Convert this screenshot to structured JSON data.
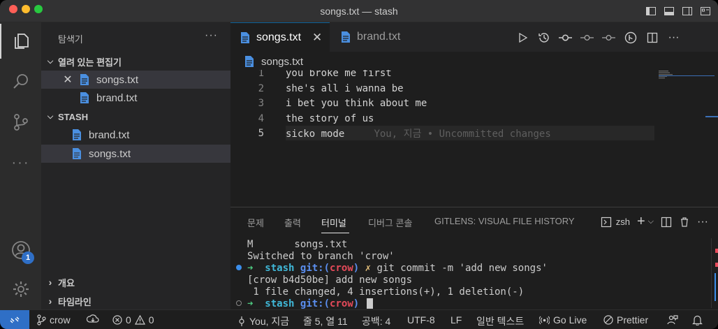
{
  "window": {
    "title": "songs.txt — stash"
  },
  "sidebar": {
    "title": "탐색기",
    "more": "···",
    "open_editors_label": "열려 있는 편집기",
    "open_editors": [
      {
        "label": "songs.txt",
        "selected": true,
        "close": "✕"
      },
      {
        "label": "brand.txt",
        "selected": false
      }
    ],
    "folder_label": "STASH",
    "folder_files": [
      {
        "label": "brand.txt",
        "selected": false
      },
      {
        "label": "songs.txt",
        "selected": true
      }
    ],
    "outline_label": "개요",
    "timeline_label": "타임라인"
  },
  "activity": {
    "accounts_badge": "1"
  },
  "tabs": [
    {
      "label": "songs.txt",
      "active": true,
      "close": "✕"
    },
    {
      "label": "brand.txt",
      "active": false
    }
  ],
  "breadcrumb": {
    "file": "songs.txt"
  },
  "editor": {
    "lines": [
      {
        "n": "1",
        "text": "you broke me first"
      },
      {
        "n": "2",
        "text": "she's all i wanna be"
      },
      {
        "n": "3",
        "text": "i bet you think about me"
      },
      {
        "n": "4",
        "text": "the story of us"
      },
      {
        "n": "5",
        "text": "sicko mode"
      }
    ],
    "current_line": 5,
    "blame": "You, 지금 • Uncommitted changes"
  },
  "panel": {
    "tabs": [
      "문제",
      "출력",
      "터미널",
      "디버그 콘솔",
      "GITLENS: VISUAL FILE HISTORY"
    ],
    "active_tab": "터미널",
    "shell": "zsh",
    "terminal": {
      "line1": "M       songs.txt",
      "line2": "Switched to branch 'crow'",
      "prompt_dir": "stash",
      "git_label": "git:(",
      "branch": "crow",
      "git_close": ")",
      "dirty": "✗",
      "command": "git commit -m 'add new songs'",
      "out1": "[crow b4d50be] add new songs",
      "out2": " 1 file changed, 4 insertions(+), 1 deletion(-)",
      "arrow": "➜"
    }
  },
  "statusbar": {
    "branch": "crow",
    "errors": "0",
    "warnings": "0",
    "blame": "You, 지금",
    "position": "줄 5, 열 11",
    "spaces": "공백: 4",
    "encoding": "UTF-8",
    "eol": "LF",
    "language": "일반 텍스트",
    "golive": "Go Live",
    "prettier": "Prettier"
  },
  "colors": {
    "accent": "#2f6fc6",
    "file_icon": "#4a8fe0"
  }
}
